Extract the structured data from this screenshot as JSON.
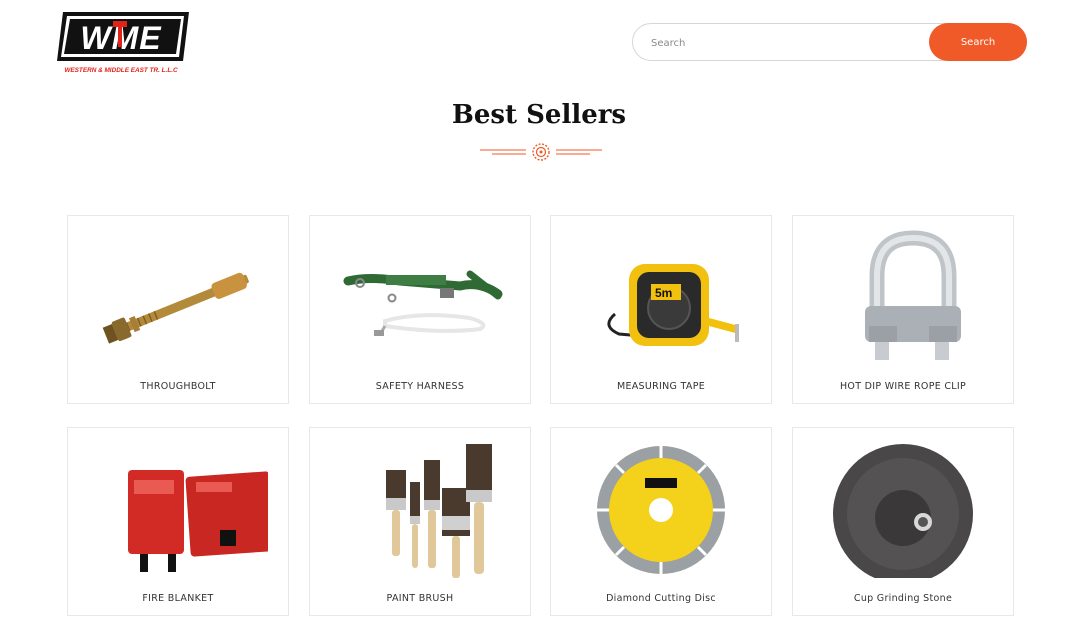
{
  "header": {
    "logo": {
      "text": "WME",
      "tagline": "WESTERN & MIDDLE EAST TR. L.L.C"
    },
    "search": {
      "placeholder": "Search",
      "button_label": "Search"
    }
  },
  "main": {
    "title": "Best Sellers",
    "products": [
      {
        "name": "THROUGHBOLT",
        "icon": "throughbolt-image"
      },
      {
        "name": "SAFETY HARNESS",
        "icon": "safety-harness-image"
      },
      {
        "name": "MEASURING TAPE",
        "icon": "measuring-tape-image"
      },
      {
        "name": "HOT DIP WIRE ROPE CLIP",
        "icon": "wire-rope-clip-image"
      },
      {
        "name": "FIRE BLANKET",
        "icon": "fire-blanket-image"
      },
      {
        "name": "PAINT BRUSH",
        "icon": "paint-brush-image"
      },
      {
        "name": "Diamond Cutting Disc",
        "icon": "cutting-disc-image"
      },
      {
        "name": "Cup Grinding Stone",
        "icon": "grinding-stone-image"
      }
    ]
  },
  "colors": {
    "accent": "#f05a28",
    "logo_red": "#e2231a",
    "text": "#111111"
  }
}
